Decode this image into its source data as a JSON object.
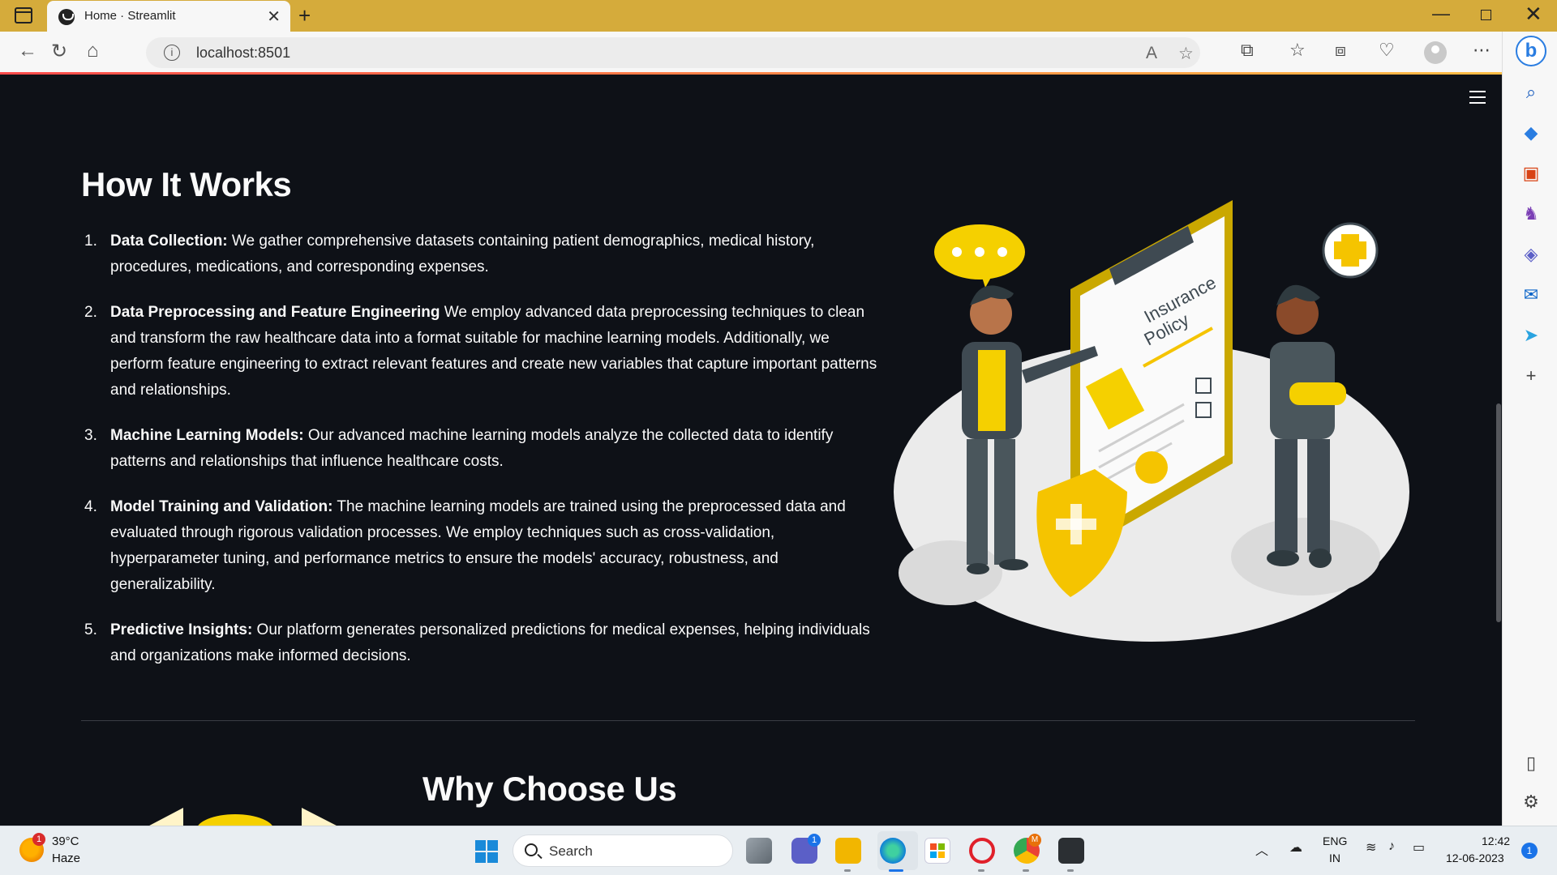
{
  "browser": {
    "tab_title": "Home · Streamlit",
    "url": "localhost:8501"
  },
  "page": {
    "heading": "How It Works",
    "steps": [
      {
        "num": "1.",
        "bold": "Data Collection:",
        "text": " We gather comprehensive datasets containing patient demographics, medical history, procedures, medications, and corresponding expenses."
      },
      {
        "num": "2.",
        "bold": "Data Preprocessing and Feature Engineering",
        "text": " We employ advanced data preprocessing techniques to clean and transform the raw healthcare data into a format suitable for machine learning models. Additionally, we perform feature engineering to extract relevant features and create new variables that capture important patterns and relationships."
      },
      {
        "num": "3.",
        "bold": "Machine Learning Models:",
        "text": " Our advanced machine learning models analyze the collected data to identify patterns and relationships that influence healthcare costs."
      },
      {
        "num": "4.",
        "bold": "Model Training and Validation:",
        "text": " The machine learning models are trained using the preprocessed data and evaluated through rigorous validation processes. We employ techniques such as cross-validation, hyperparameter tuning, and performance metrics to ensure the models' accuracy, robustness, and generalizability."
      },
      {
        "num": "5.",
        "bold": "Predictive Insights:",
        "text": " Our platform generates personalized predictions for medical expenses, helping individuals and organizations make informed decisions."
      }
    ],
    "illustration_text_line1": "Insurance",
    "illustration_text_line2": "Policy",
    "section2_heading": "Why Choose Us"
  },
  "taskbar": {
    "weather_temp": "39°C",
    "weather_condition": "Haze",
    "weather_badge": "1",
    "search_label": "Search",
    "lang_line1": "ENG",
    "lang_line2": "IN",
    "time": "12:42",
    "date": "12-06-2023",
    "notification_count": "1",
    "teams_badge": "1",
    "chrome_badge": "M"
  },
  "colors": {
    "app_background": "#0e1117",
    "text": "#fafafa",
    "accent_yellow": "#f5c400",
    "tab_bar": "#d5ab3b"
  }
}
